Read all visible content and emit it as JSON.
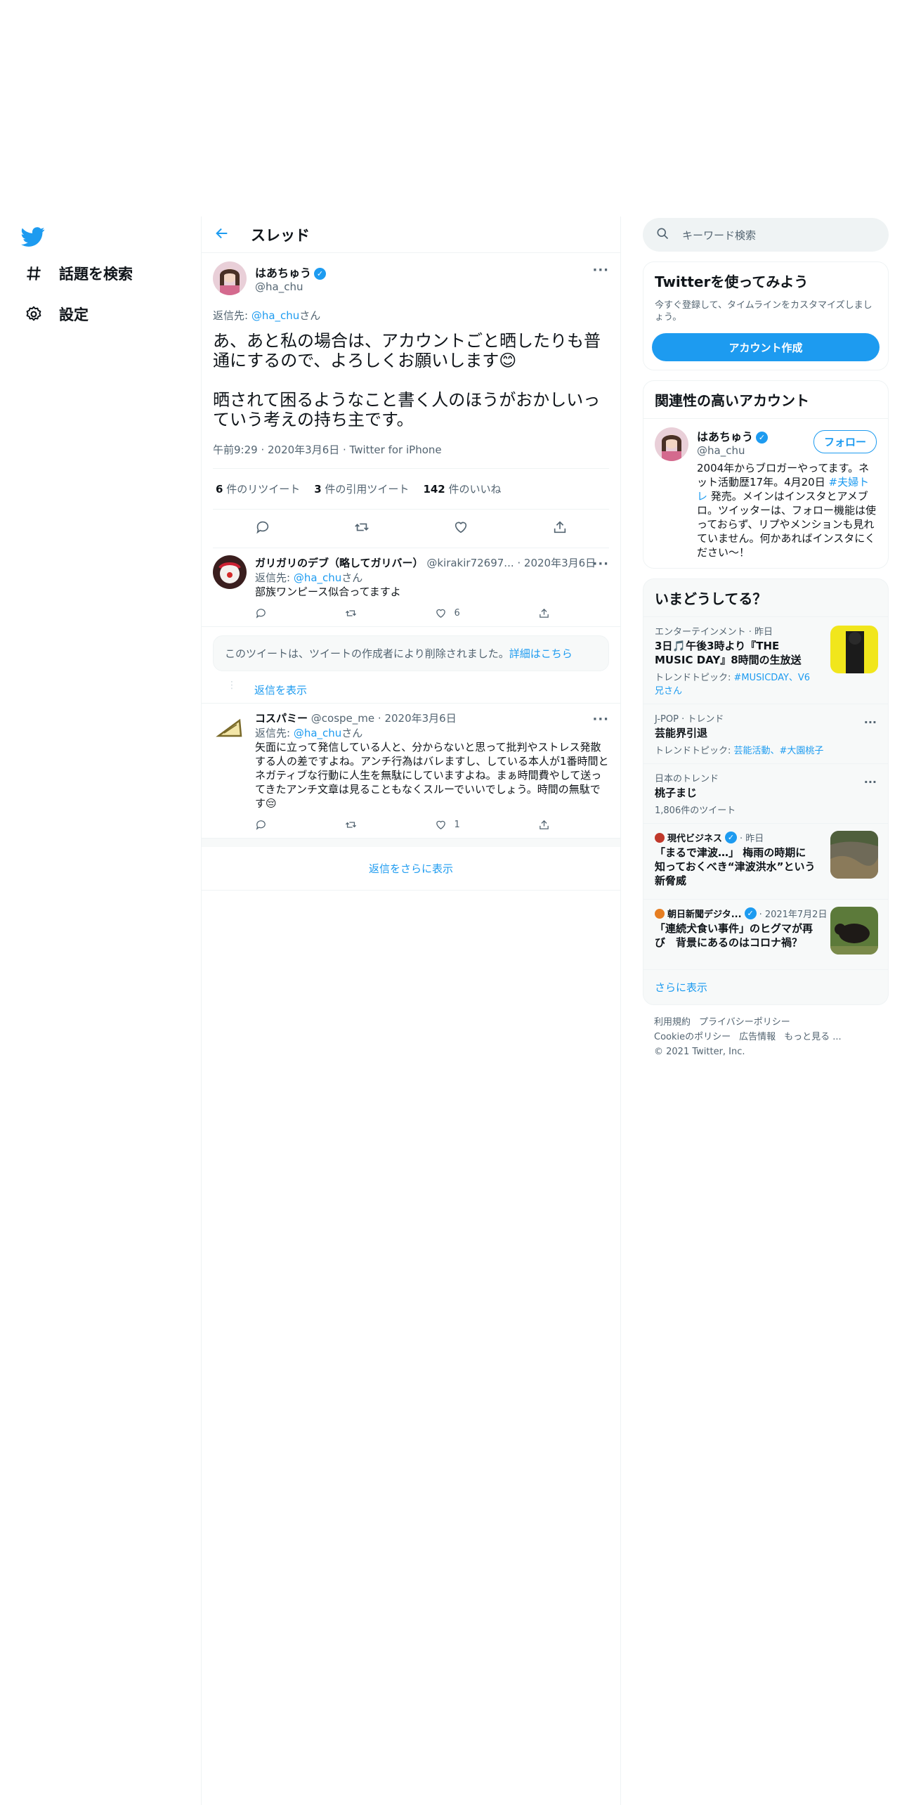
{
  "nav": {
    "explore_label": "話題を検索",
    "settings_label": "設定"
  },
  "header": {
    "title": "スレッド"
  },
  "main_tweet": {
    "name": "はあちゅう",
    "handle": "@ha_chu",
    "reply_prefix": "返信先: ",
    "reply_handle": "@ha_chu",
    "reply_suffix": "さん",
    "text": "あ、あと私の場合は、アカウントごと晒したりも普通にするので、よろしくお願いします😊\n\n晒されて困るようなこと書く人のほうがおかしいっていう考えの持ち主です。",
    "meta": "午前9:29 · 2020年3月6日 · Twitter for iPhone",
    "retweets_count": "6",
    "retweets_label": " 件のリツイート",
    "quotes_count": "3",
    "quotes_label": " 件の引用ツイート",
    "likes_count": "142",
    "likes_label": " 件のいいね"
  },
  "reply1": {
    "name": "ガリガリのデブ（略してガリバー）",
    "handle": "@kirakir72697...",
    "date": " · 2020年3月6日",
    "reply_prefix": "返信先: ",
    "reply_handle": "@ha_chu",
    "reply_suffix": "さん",
    "text": "部族ワンピース似合ってますよ",
    "likes": "6"
  },
  "deleted": {
    "text": "このツイートは、ツイートの作成者により削除されました。",
    "link": "詳細はこちら"
  },
  "show_replies": "返信を表示",
  "reply2": {
    "name": "コスパミー",
    "handle": "@cospe_me",
    "date": " · 2020年3月6日",
    "reply_prefix": "返信先: ",
    "reply_handle": "@ha_chu",
    "reply_suffix": "さん",
    "text": "矢面に立って発信している人と、分からないと思って批判やストレス発散する人の差ですよね。アンチ行為はバレますし、している本人が1番時間とネガティブな行動に人生を無駄にしていますよね。まぁ時間費やして送ってきたアンチ文章は見ることもなくスルーでいいでしょう。時間の無駄です😔",
    "likes": "1"
  },
  "more_replies": "返信をさらに表示",
  "search": {
    "placeholder": "キーワード検索"
  },
  "try_card": {
    "title": "Twitterを使ってみよう",
    "subtitle": "今すぐ登録して、タイムラインをカスタマイズしましょう。",
    "button": "アカウント作成"
  },
  "related": {
    "title": "関連性の高いアカウント",
    "name": "はあちゅう",
    "handle": "@ha_chu",
    "follow": "フォロー",
    "bio_pre": "2004年からブロガーやってます。ネット活動歴17年。4月20日 ",
    "bio_tag": "#夫婦トレ",
    "bio_post": " 発売。メインはインスタとアメブロ。ツイッターは、フォロー機能は使っておらず、リプやメンションも見れていません。何かあればインスタにください〜！"
  },
  "trends": {
    "title": "いまどうしてる？",
    "items": [
      {
        "meta": "エンターテインメント · 昨日",
        "name": "3日🎵午後3時より『THE MUSIC DAY』8時間の生放送",
        "topic_label": "トレンドトピック: ",
        "topic": "#MUSICDAY、V6兄さん"
      },
      {
        "meta": "J-POP · トレンド",
        "name": "芸能界引退",
        "topic_label": "トレンドトピック: ",
        "topic": "芸能活動、#大園桃子"
      },
      {
        "meta": "日本のトレンド",
        "name": "桃子まじ",
        "count": "1,806件のツイート"
      }
    ],
    "news": [
      {
        "source": "現代ビジネス",
        "time": " · 昨日",
        "headline": "「まるで津波…」 梅雨の時期に知っておくべき“津波洪水”という新脅威"
      },
      {
        "source": "朝日新聞デジタ...",
        "time": " · 2021年7月2日",
        "headline": "「連続犬食い事件」のヒグマが再び　背景にあるのはコロナ禍？"
      }
    ],
    "show_more": "さらに表示"
  },
  "footer": {
    "terms": "利用規約",
    "privacy": "プライバシーポリシー",
    "cookie": "Cookieのポリシー",
    "ads": "広告情報",
    "more": "もっと見る ...",
    "copyright": "© 2021 Twitter, Inc."
  },
  "colors": {
    "accent": "#1d9bf0",
    "muted": "#536471",
    "text": "#0f1419"
  }
}
